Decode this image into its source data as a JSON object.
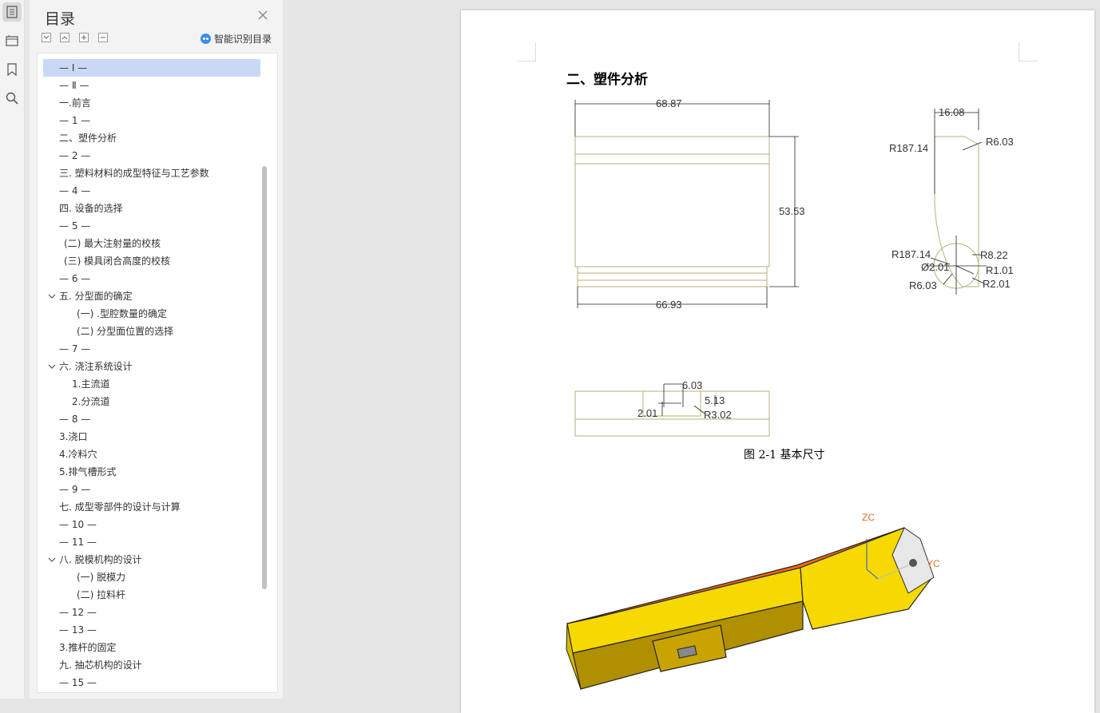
{
  "toc": {
    "title": "目录",
    "smart_label": "智能识别目录",
    "items": [
      {
        "text": "— Ⅰ —",
        "indent": 20,
        "selected": true
      },
      {
        "text": "— Ⅱ —",
        "indent": 20
      },
      {
        "text": "一.前言",
        "indent": 20
      },
      {
        "text": "— 1 —",
        "indent": 20
      },
      {
        "text": "二、塑件分析",
        "indent": 20
      },
      {
        "text": "— 2 —",
        "indent": 20
      },
      {
        "text": "三. 塑料材料的成型特征与工艺参数",
        "indent": 20
      },
      {
        "text": "— 4 —",
        "indent": 20
      },
      {
        "text": "四. 设备的选择",
        "indent": 20
      },
      {
        "text": "— 5 —",
        "indent": 20
      },
      {
        "text": "(二) 最大注射量的校核",
        "indent": 26
      },
      {
        "text": "(三) 模具闭合高度的校核",
        "indent": 26
      },
      {
        "text": "— 6 —",
        "indent": 20
      },
      {
        "text": "五. 分型面的确定",
        "indent": 20,
        "expand": true
      },
      {
        "text": "(一) .型腔数量的确定",
        "indent": 42
      },
      {
        "text": "(二) 分型面位置的选择",
        "indent": 42
      },
      {
        "text": "— 7 —",
        "indent": 20
      },
      {
        "text": "六. 浇注系统设计",
        "indent": 20,
        "expand": true
      },
      {
        "text": "1.主流道",
        "indent": 36
      },
      {
        "text": "2.分流道",
        "indent": 36
      },
      {
        "text": "— 8 —",
        "indent": 20
      },
      {
        "text": "3.浇口",
        "indent": 20
      },
      {
        "text": "4.冷料穴",
        "indent": 20
      },
      {
        "text": "5.排气槽形式",
        "indent": 20
      },
      {
        "text": "— 9 —",
        "indent": 20
      },
      {
        "text": "七. 成型零部件的设计与计算",
        "indent": 20
      },
      {
        "text": "— 10 —",
        "indent": 20
      },
      {
        "text": "— 11 —",
        "indent": 20
      },
      {
        "text": "八. 脱模机构的设计",
        "indent": 20,
        "expand": true
      },
      {
        "text": "(一) 脱模力",
        "indent": 42
      },
      {
        "text": "(二) 拉料杆",
        "indent": 42
      },
      {
        "text": "— 12 —",
        "indent": 20
      },
      {
        "text": "— 13 —",
        "indent": 20
      },
      {
        "text": "3.推杆的固定",
        "indent": 20
      },
      {
        "text": "九. 抽芯机构的设计",
        "indent": 20
      },
      {
        "text": "— 15 —",
        "indent": 20
      }
    ]
  },
  "document": {
    "heading": "二、塑件分析",
    "caption": "图 2-1 基本尺寸",
    "dimensions": {
      "top_width": "68.87",
      "height": "53.53",
      "bottom_width": "66.93",
      "side_width": "16.08",
      "r_top": "R187.14",
      "r_corner": "R6.03",
      "r_bottom": "R187.14",
      "r_822": "R8.22",
      "phi": "Ø2.01",
      "r_101": "R1.01",
      "r_603b": "R6.03",
      "r_201": "R2.01",
      "d_603": "6.03",
      "d_513": "5.13",
      "d_201": "2.01",
      "r_302": "R3.02"
    },
    "axis_z": "ZC",
    "axis_y": "YC"
  },
  "colors": {
    "selected_bg": "#c9d9f5",
    "accent_blue": "#3a8ee6",
    "cad_line": "#b5b27a",
    "body_yellow": "#f5d900",
    "body_dark": "#b08f00",
    "body_orange": "#f06a10"
  }
}
